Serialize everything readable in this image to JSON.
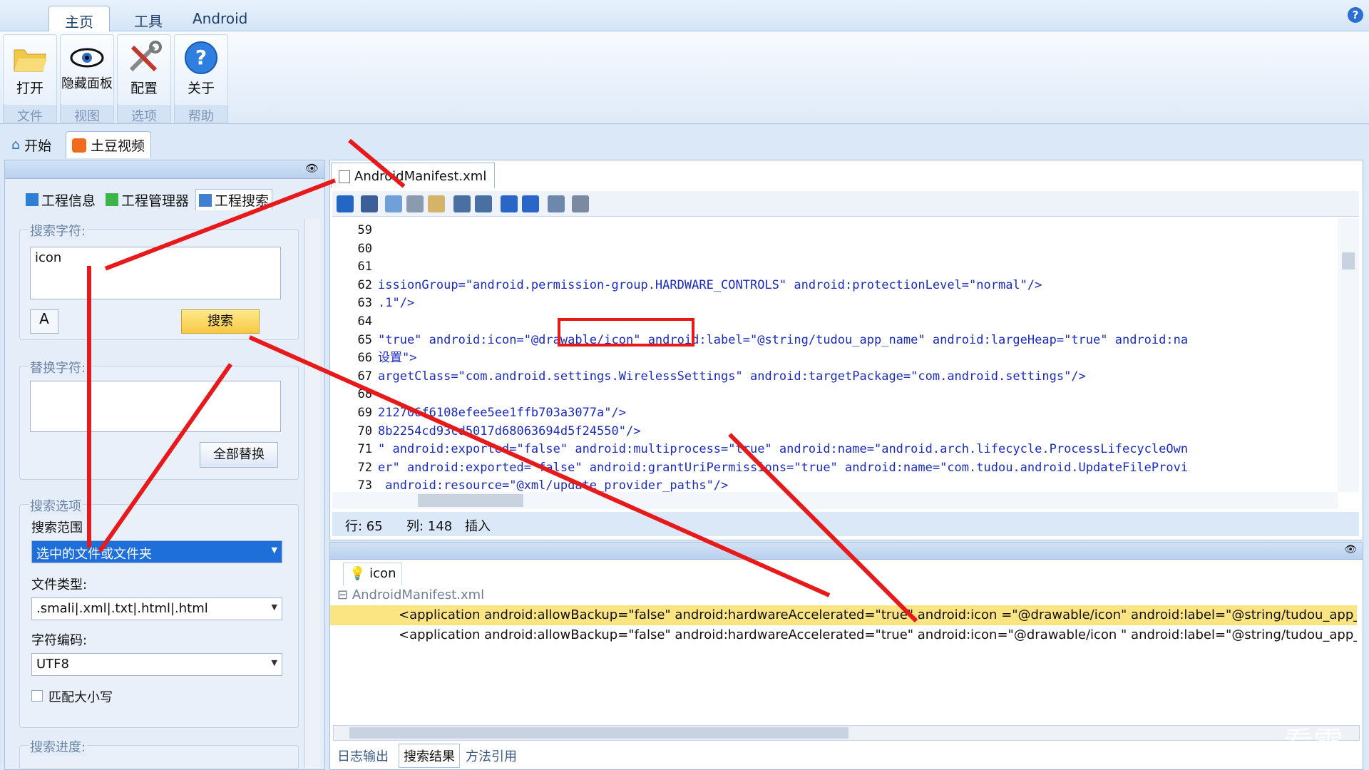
{
  "ribbon_tabs": [
    "主页",
    "工具",
    "Android"
  ],
  "ribbon_buttons": [
    {
      "label": "打开",
      "group": "文件"
    },
    {
      "label": "隐藏面板",
      "group": "视图"
    },
    {
      "label": "配置",
      "group": "选项"
    },
    {
      "label": "关于",
      "group": "帮助"
    }
  ],
  "doc_tabs": [
    "开始",
    "土豆视频"
  ],
  "left_tabs": [
    "工程信息",
    "工程管理器",
    "工程搜索"
  ],
  "search": {
    "title": "搜索字符:",
    "value": "icon",
    "button": "搜索",
    "replace_title": "替换字符:",
    "replace_value": "",
    "replace_all": "全部替换",
    "options_title": "搜索选项",
    "scope_label": "搜索范围",
    "scope_value": "选中的文件或文件夹",
    "filetype_label": "文件类型:",
    "filetype_value": ".smali|.xml|.txt|.html|.html",
    "encoding_label": "字符编码:",
    "encoding_value": "UTF8",
    "case_label": "匹配大小写",
    "progress_title": "搜索进度:"
  },
  "editor": {
    "file_tab": "AndroidManifest.xml",
    "lines": [
      {
        "n": "59",
        "t": ""
      },
      {
        "n": "60",
        "t": ""
      },
      {
        "n": "61",
        "t": ""
      },
      {
        "n": "62",
        "t": "issionGroup=\"android.permission-group.HARDWARE_CONTROLS\" android:protectionLevel=\"normal\"/>"
      },
      {
        "n": "63",
        "t": ".1\"/>"
      },
      {
        "n": "64",
        "t": ""
      },
      {
        "n": "65",
        "t": "\"true\" android:icon=\"@drawable/icon\" android:label=\"@string/tudou_app_name\" android:largeHeap=\"true\" android:na"
      },
      {
        "n": "66",
        "t": "设置\">"
      },
      {
        "n": "67",
        "t": "argetClass=\"com.android.settings.WirelessSettings\" android:targetPackage=\"com.android.settings\"/>"
      },
      {
        "n": "68",
        "t": ""
      },
      {
        "n": "69",
        "t": "212706f6108efee5ee1ffb703a3077a\"/>"
      },
      {
        "n": "70",
        "t": "8b2254cd93cd5017d68063694d5f24550\"/>"
      },
      {
        "n": "71",
        "t": "\" android:exported=\"false\" android:multiprocess=\"true\" android:name=\"android.arch.lifecycle.ProcessLifecycleOwn"
      },
      {
        "n": "72",
        "t": "er\" android:exported=\"false\" android:grantUriPermissions=\"true\" android:name=\"com.tudou.android.UpdateFileProvi"
      },
      {
        "n": "73",
        "t": " android:resource=\"@xml/update_provider_paths\"/>"
      }
    ],
    "status_row": "行: 65",
    "status_col": "列: 148",
    "status_mode": "插入"
  },
  "results": {
    "tab_label": "icon",
    "file": "AndroidManifest.xml",
    "rows": [
      "<application android:allowBackup=\"false\" android:hardwareAccelerated=\"true\" android:icon =\"@drawable/icon\" android:label=\"@string/tudou_app_name",
      "<application android:allowBackup=\"false\" android:hardwareAccelerated=\"true\" android:icon=\"@drawable/icon \" android:label=\"@string/tudou_app_name"
    ],
    "bottom_tabs": [
      "日志输出",
      "搜索结果",
      "方法引用"
    ]
  },
  "watermark": "看雪"
}
